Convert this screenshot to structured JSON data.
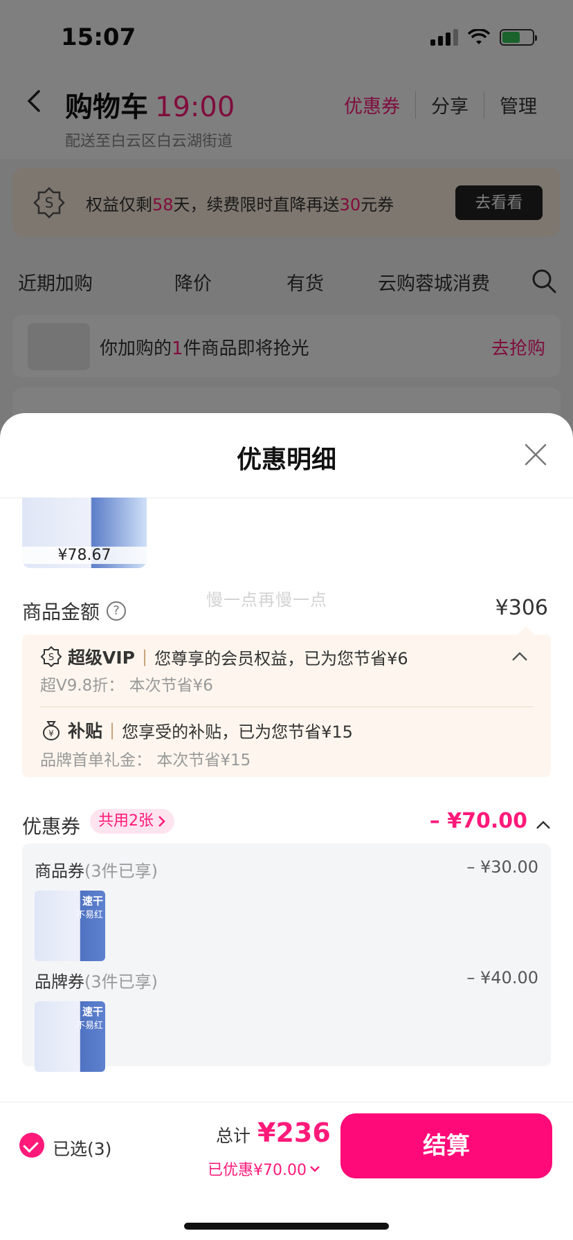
{
  "status_bar": {
    "time": "15:07"
  },
  "header": {
    "title": "购物车",
    "time": "19:00",
    "address": "配送至白云区白云湖街道",
    "actions": [
      "优惠券",
      "分享",
      "管理"
    ]
  },
  "vip_banner": {
    "text_pre": "权益仅剩",
    "days": "58",
    "text_mid": "天，续费限时直降再送",
    "amount": "30",
    "text_post": "元券",
    "button": "去看看"
  },
  "filter_tabs": [
    "近期加购",
    "降价",
    "有货",
    "云购蓉城消费"
  ],
  "soon_row": {
    "text_pre": "你加购的",
    "count": "1",
    "text_post": "件商品即将抢光",
    "action": "去抢购"
  },
  "sheet": {
    "title": "优惠明细",
    "product_price": "¥78.67",
    "watermark": "慢一点再慢一点",
    "amount_label": "商品金额",
    "amount_value": "¥306",
    "benefits": [
      {
        "tag": "超级VIP",
        "desc": "您尊享的会员权益，已为您节省¥6",
        "sub_label": "超V9.8折：",
        "sub_value": "本次节省¥6"
      },
      {
        "tag": "补贴",
        "desc": "您享受的补贴，已为您节省¥15",
        "sub_label": "品牌首单礼金：",
        "sub_value": "本次节省¥15"
      }
    ],
    "coupon_label": "优惠券",
    "coupon_share_tag": "共用2张",
    "coupon_total": "– ¥70.00",
    "coupons": [
      {
        "name": "商品券",
        "note": "(3件已享)",
        "amount": "– ¥30.00",
        "thumb_t1": "速干",
        "thumb_t2": "不易红"
      },
      {
        "name": "品牌券",
        "note": "(3件已享)",
        "amount": "– ¥40.00",
        "thumb_t1": "速干",
        "thumb_t2": "不易红"
      }
    ]
  },
  "bottom_bar": {
    "selected": "已选(3)",
    "total_label": "总计",
    "total_value": "¥236",
    "saved": "已优惠¥70.00",
    "checkout": "结算"
  },
  "colors": {
    "accent": "#ff1a7a",
    "checkout": "#ff0a78"
  }
}
